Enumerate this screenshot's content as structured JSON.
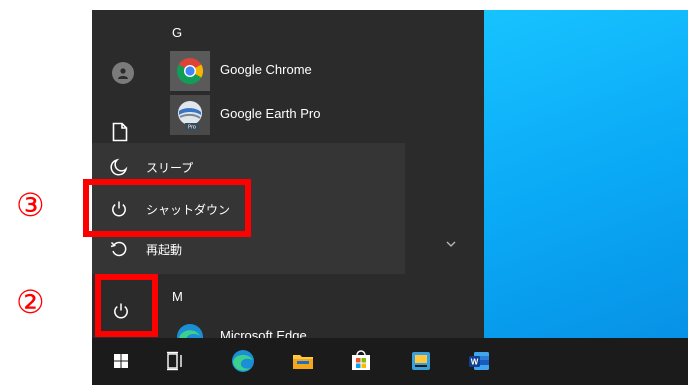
{
  "start_menu": {
    "sections": {
      "g": "G",
      "m": "M"
    },
    "apps": [
      {
        "label": "Google Chrome",
        "icon": "chrome-icon"
      },
      {
        "label": "Google Earth Pro",
        "icon": "google-earth-pro-icon",
        "badge": "Pro"
      },
      {
        "label": "Microsoft Edge",
        "icon": "edge-icon"
      }
    ],
    "left_rail": [
      "user-avatar-icon",
      "document-icon",
      "power-icon"
    ]
  },
  "power_menu": {
    "items": [
      {
        "label": "スリープ",
        "icon": "moon-icon"
      },
      {
        "label": "シャットダウン",
        "icon": "power-icon"
      },
      {
        "label": "再起動",
        "icon": "restart-icon"
      }
    ]
  },
  "annotations": {
    "step_2": "②",
    "step_3": "③",
    "highlight_color": "#ff0000"
  },
  "taskbar": {
    "items": [
      "windows-start-icon",
      "task-view-icon",
      "edge-icon",
      "file-explorer-icon",
      "microsoft-store-icon",
      "photos-app-icon",
      "word-icon"
    ],
    "word_letter": "W"
  },
  "colors": {
    "start_menu_bg": "#2b2b2b",
    "power_menu_bg": "#353535",
    "taskbar_bg": "#1b1b1b",
    "desktop_blue": "#0aa8f5"
  }
}
